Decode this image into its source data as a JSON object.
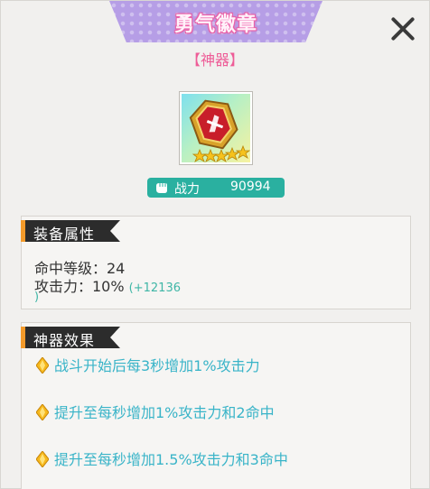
{
  "header": {
    "title": "勇气徽章",
    "subtitle": "【神器】"
  },
  "item": {
    "icon": "badge-icon",
    "stars": 5
  },
  "power": {
    "label": "战力",
    "value": "90994"
  },
  "attributes": {
    "heading": "装备属性",
    "line1": "命中等级：24",
    "line2": "攻击力：10%",
    "line2_bonus": "(+12136",
    "line2_bonus_end": ")"
  },
  "effects": {
    "heading": "神器效果",
    "items": [
      "战斗开始后每3秒增加1%攻击力",
      "提升至每秒增加1%攻击力和2命中",
      "提升至每秒增加1.5%攻击力和3命中"
    ]
  },
  "colors": {
    "title_tab": "#b69ee6",
    "title_text_glow": "#e45aa0",
    "subtitle": "#ee5c97",
    "power_bar": "#2ab0a0",
    "effect_text": "#39b4c8",
    "header_accent": "#f39a2a"
  }
}
